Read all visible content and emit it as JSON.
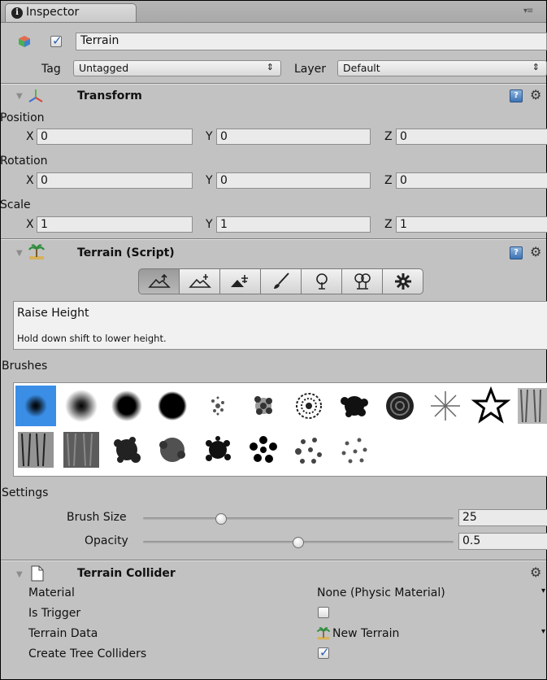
{
  "tab": {
    "title": "Inspector"
  },
  "object": {
    "name": "Terrain",
    "active": true,
    "tag_label": "Tag",
    "tag_value": "Untagged",
    "layer_label": "Layer",
    "layer_value": "Default"
  },
  "transform": {
    "title": "Transform",
    "position_label": "Position",
    "rotation_label": "Rotation",
    "scale_label": "Scale",
    "axis_x": "X",
    "axis_y": "Y",
    "axis_z": "Z",
    "position": {
      "x": "0",
      "y": "0",
      "z": "0"
    },
    "rotation": {
      "x": "0",
      "y": "0",
      "z": "0"
    },
    "scale": {
      "x": "1",
      "y": "1",
      "z": "1"
    }
  },
  "terrain_script": {
    "title": "Terrain (Script)",
    "toolbar": [
      "raise-lower-terrain",
      "paint-height",
      "smooth-height",
      "paint-texture",
      "place-trees",
      "paint-details",
      "terrain-settings"
    ],
    "selected_tool": 0,
    "tool_name": "Raise Height",
    "tool_hint": "Hold down shift to lower height.",
    "brushes_label": "Brushes",
    "brush_count": 20,
    "selected_brush": 0,
    "settings_label": "Settings",
    "brush_size_label": "Brush Size",
    "brush_size_value": "25",
    "brush_size_fraction": 0.25,
    "opacity_label": "Opacity",
    "opacity_value": "0.5",
    "opacity_fraction": 0.5
  },
  "terrain_collider": {
    "title": "Terrain Collider",
    "material_label": "Material",
    "material_value": "None (Physic Material)",
    "is_trigger_label": "Is Trigger",
    "is_trigger": false,
    "terrain_data_label": "Terrain Data",
    "terrain_data_value": "New Terrain",
    "create_tree_colliders_label": "Create Tree Colliders",
    "create_tree_colliders": true
  },
  "colors": {
    "selection_blue": "#3a8ee6",
    "panel_gray": "#c2c2c2"
  }
}
